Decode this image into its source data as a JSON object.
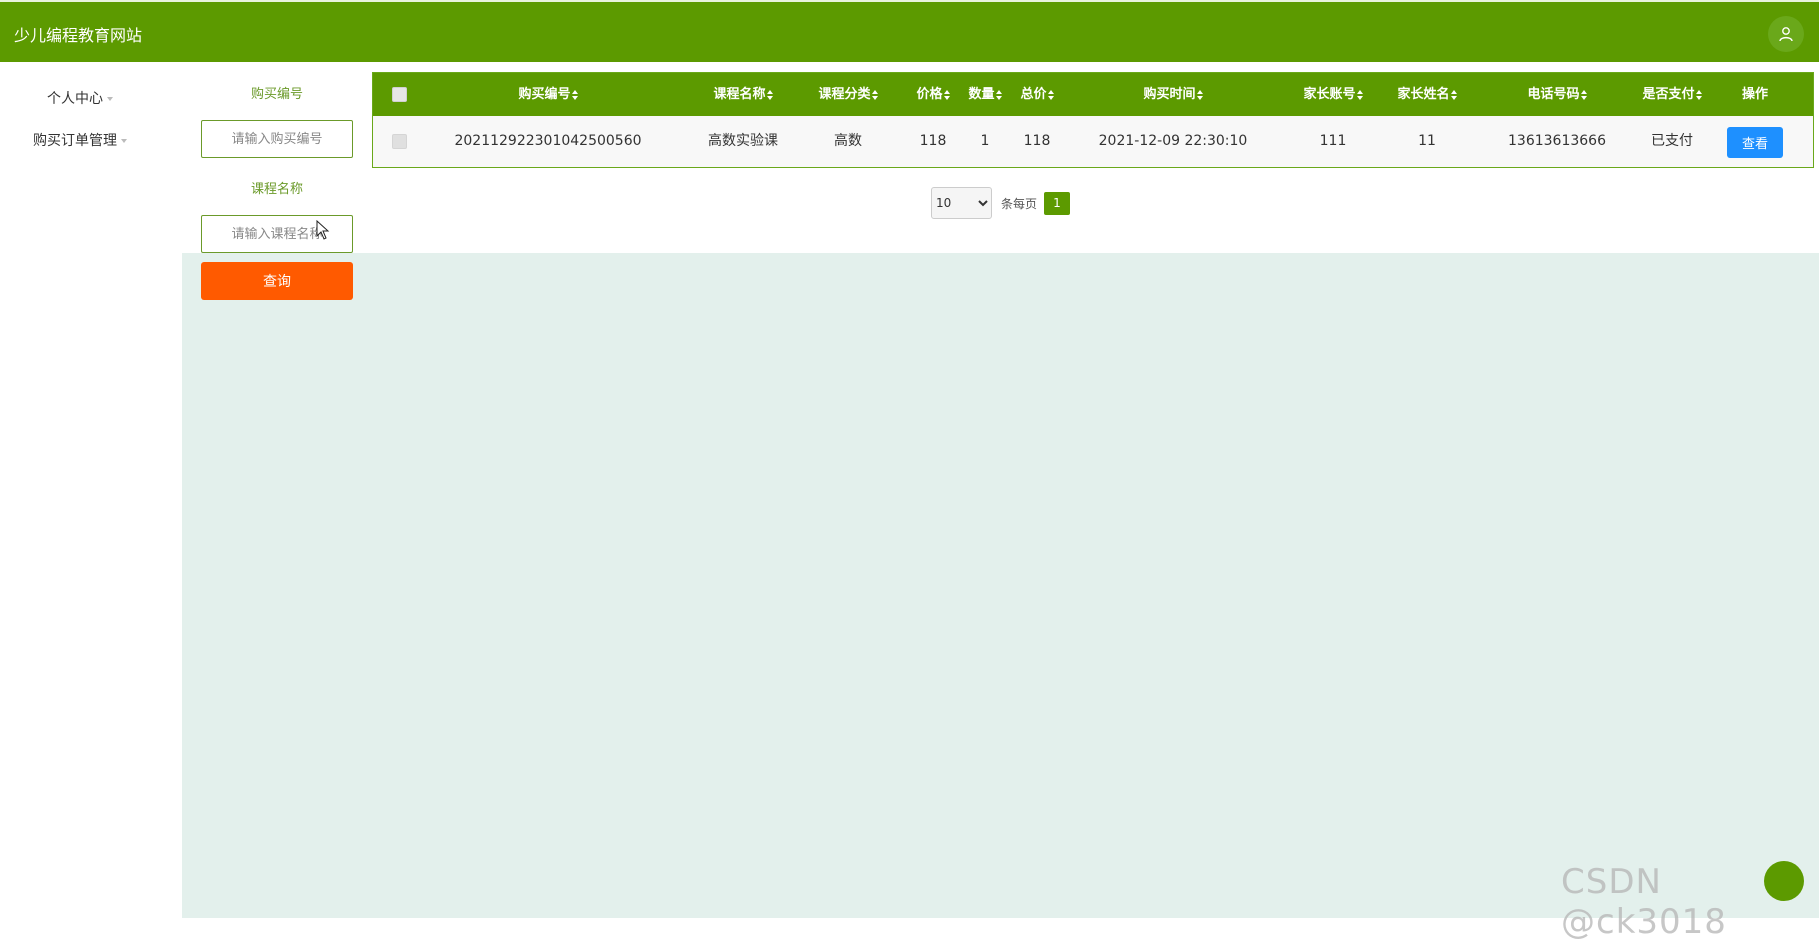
{
  "header": {
    "title": "少儿编程教育网站",
    "user_icon": "user-icon"
  },
  "sidebar": {
    "items": [
      {
        "label": "个人中心"
      },
      {
        "label": "购买订单管理"
      }
    ]
  },
  "filters": {
    "purchase_no_label": "购买编号",
    "purchase_no_placeholder": "请输入购买编号",
    "course_name_label": "课程名称",
    "course_name_placeholder": "请输入课程名称",
    "search_label": "查询"
  },
  "table": {
    "columns": [
      "购买编号",
      "课程名称",
      "课程分类",
      "价格",
      "数量",
      "总价",
      "购买时间",
      "家长账号",
      "家长姓名",
      "电话号码",
      "是否支付",
      "操作"
    ],
    "rows": [
      {
        "purchase_no": "202112922301042500560",
        "course_name": "高数实验课",
        "category": "高数",
        "price": "118",
        "quantity": "1",
        "total": "118",
        "time": "2021-12-09 22:30:10",
        "parent_account": "111",
        "parent_name": "11",
        "phone": "13613613666",
        "paid": "已支付",
        "action_label": "查看"
      }
    ]
  },
  "pagination": {
    "page_size": "10",
    "page_size_options": [
      "10"
    ],
    "per_page_label": "条每页",
    "current_page": "1"
  },
  "watermark": "CSDN @ck3018",
  "colors": {
    "primary": "#5c9a00",
    "search": "#ff5a00",
    "view": "#1e90ff",
    "content_bg": "#e3f0ec"
  }
}
